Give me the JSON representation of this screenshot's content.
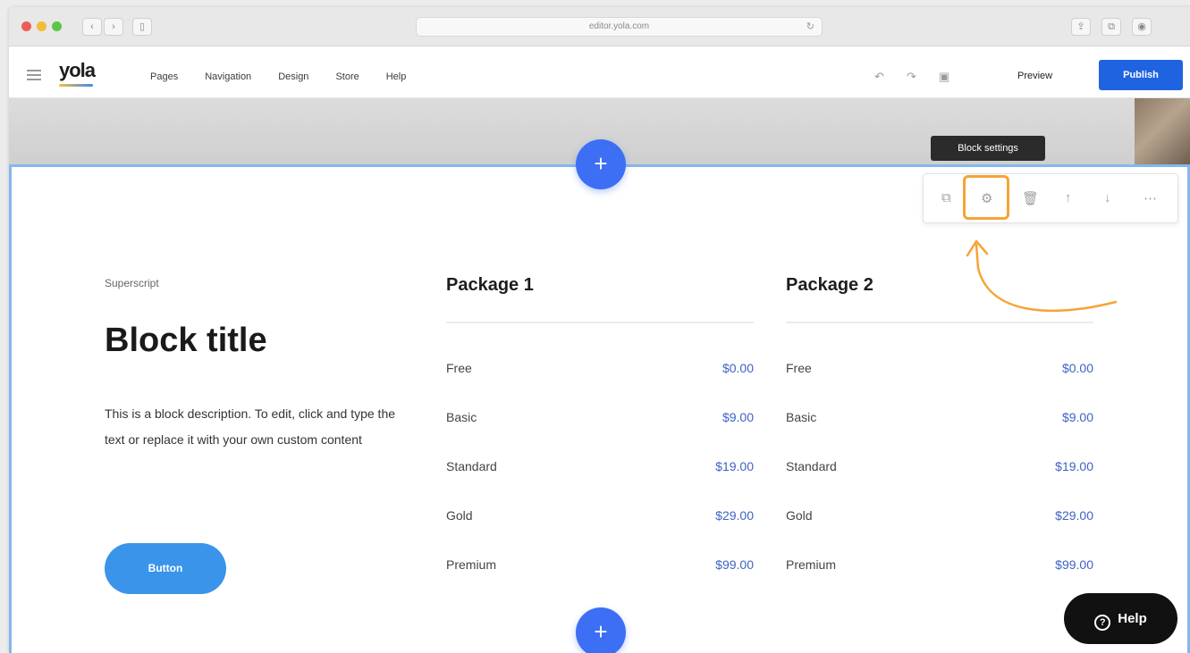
{
  "browser": {
    "url": "editor.yola.com",
    "icons": {
      "back": "chevron-left",
      "forward": "chevron-right",
      "sidebar": "sidebar",
      "reload": "reload",
      "share": "share",
      "tabs": "tabs",
      "extension": "extension"
    }
  },
  "app": {
    "logo": "yola",
    "menu": [
      "Pages",
      "Navigation",
      "Design",
      "Store",
      "Help"
    ],
    "preview_label": "Preview",
    "publish_label": "Publish",
    "accent": "#1f63e0"
  },
  "block": {
    "toolbar_tooltip": "Block settings",
    "superscript": "Superscript",
    "title": "Block title",
    "description": "This is a block description. To edit, click and type the text or replace it with your own custom content",
    "button_label": "Button"
  },
  "packages": [
    {
      "title": "Package 1",
      "rows": [
        {
          "name": "Free",
          "price": "$0.00"
        },
        {
          "name": "Basic",
          "price": "$9.00"
        },
        {
          "name": "Standard",
          "price": "$19.00"
        },
        {
          "name": "Gold",
          "price": "$29.00"
        },
        {
          "name": "Premium",
          "price": "$99.00"
        }
      ]
    },
    {
      "title": "Package 2",
      "rows": [
        {
          "name": "Free",
          "price": "$0.00"
        },
        {
          "name": "Basic",
          "price": "$9.00"
        },
        {
          "name": "Standard",
          "price": "$19.00"
        },
        {
          "name": "Gold",
          "price": "$29.00"
        },
        {
          "name": "Premium",
          "price": "$99.00"
        }
      ]
    }
  ],
  "help": {
    "label": "Help"
  }
}
